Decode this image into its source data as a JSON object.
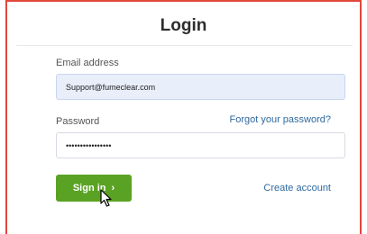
{
  "form": {
    "title": "Login",
    "email_label": "Email address",
    "email_value": "Support@fumeclear.com",
    "password_label": "Password",
    "forgot_link": "Forgot your password?",
    "password_value": "••••••••••••••••",
    "signin_label": "Sign in",
    "signin_icon": "chevron-right-icon",
    "create_account_link": "Create account"
  },
  "colors": {
    "frame_border": "#e2473b",
    "signin_button": "#5aa224",
    "link": "#2f6a9e",
    "email_input_bg": "#e8effb"
  }
}
